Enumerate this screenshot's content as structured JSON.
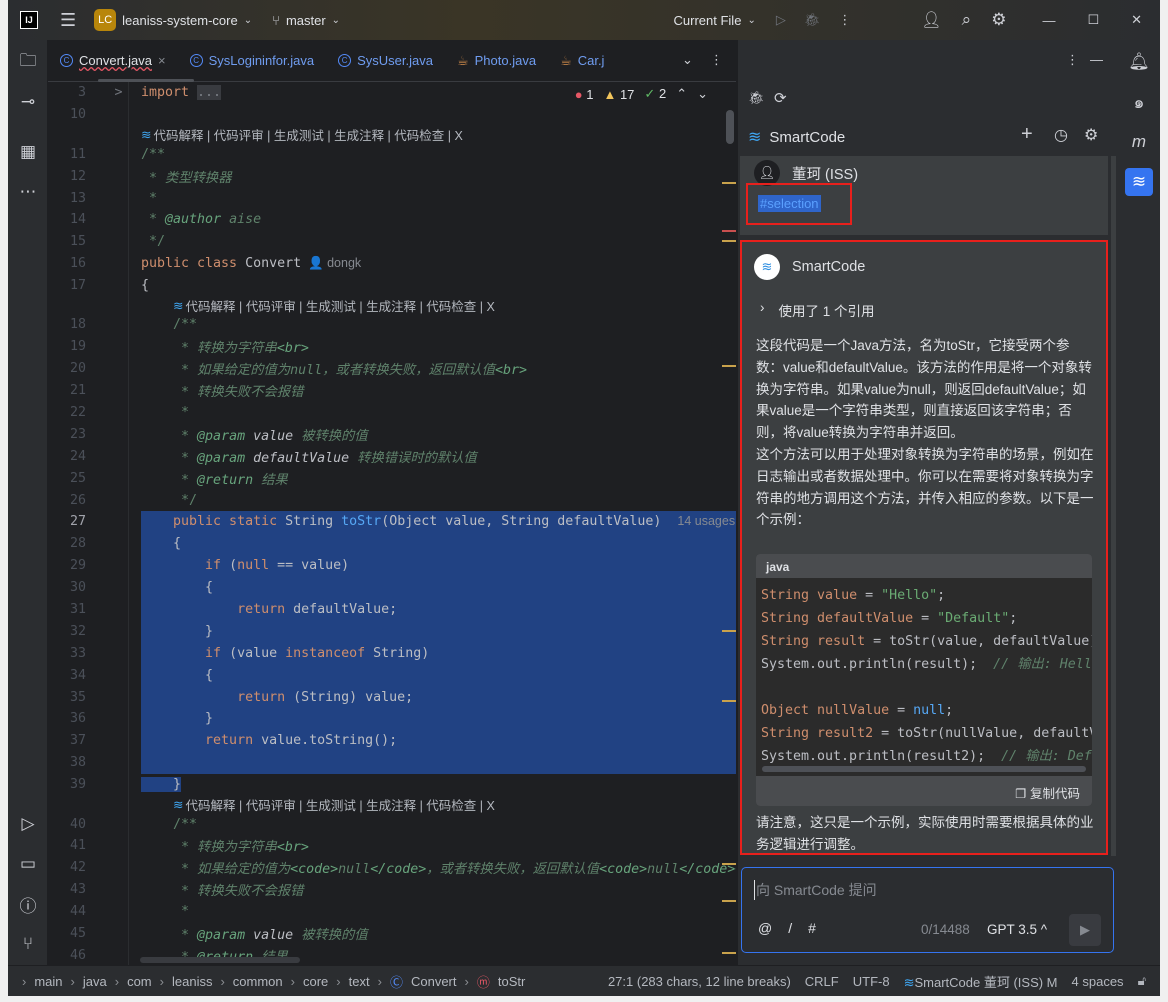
{
  "titlebar": {
    "logo": "IJ",
    "project_badge": "LC",
    "project": "leaniss-system-core",
    "branch": "master",
    "run_config": "Current File"
  },
  "tabs": [
    {
      "label": "Convert.java",
      "icon": "class-icon",
      "active": true,
      "close": "×"
    },
    {
      "label": "SysLogininfor.java",
      "icon": "class-icon"
    },
    {
      "label": "SysUser.java",
      "icon": "class-icon"
    },
    {
      "label": "Photo.java",
      "icon": "java-cup-icon"
    },
    {
      "label": "Car.j",
      "icon": "java-cup-icon"
    }
  ],
  "inspections": {
    "errors": "1",
    "warnings": "17",
    "ok": "2"
  },
  "lens": {
    "actions": "代码解释 | 代码评审 | 生成测试 | 生成注释 | 代码检查 | X"
  },
  "code_rows": [
    {
      "n": "3",
      "fold": ">",
      "seg": [
        {
          "t": "import ",
          "k": "kw"
        },
        {
          "t": "...",
          "k": "fold"
        }
      ]
    },
    {
      "n": "10",
      "seg": []
    },
    {
      "lens": true,
      "indent": ""
    },
    {
      "n": "11",
      "seg": [
        {
          "t": "/**",
          "k": "cmb"
        }
      ]
    },
    {
      "n": "12",
      "seg": [
        {
          "t": " * 类型转换器",
          "k": "cm"
        }
      ]
    },
    {
      "n": "13",
      "seg": [
        {
          "t": " *",
          "k": "cm"
        }
      ]
    },
    {
      "n": "14",
      "seg": [
        {
          "t": " * ",
          "k": "cm"
        },
        {
          "t": "@author",
          "k": "tag"
        },
        {
          "t": " aise",
          "k": "cm"
        }
      ]
    },
    {
      "n": "15",
      "seg": [
        {
          "t": " */",
          "k": "cmb"
        }
      ]
    },
    {
      "n": "16",
      "seg": [
        {
          "t": "public class ",
          "k": "kw"
        },
        {
          "t": "Convert",
          "k": "pl"
        },
        {
          "t": "  👤 dongk",
          "k": "hint"
        }
      ]
    },
    {
      "n": "17",
      "seg": [
        {
          "t": "{",
          "k": "pl"
        }
      ]
    },
    {
      "lens": true,
      "indent": "    "
    },
    {
      "n": "18",
      "seg": [
        {
          "t": "    /**",
          "k": "cmb"
        }
      ]
    },
    {
      "n": "19",
      "seg": [
        {
          "t": "     * 转换为字符串",
          "k": "cm"
        },
        {
          "t": "<br>",
          "k": "tag"
        }
      ]
    },
    {
      "n": "20",
      "seg": [
        {
          "t": "     * 如果给定的值为null，或者转换失败，返回默认值",
          "k": "cm"
        },
        {
          "t": "<br>",
          "k": "tag"
        }
      ]
    },
    {
      "n": "21",
      "seg": [
        {
          "t": "     * 转换失败不会报错",
          "k": "cm"
        }
      ]
    },
    {
      "n": "22",
      "seg": [
        {
          "t": "     *",
          "k": "cm"
        }
      ]
    },
    {
      "n": "23",
      "seg": [
        {
          "t": "     * ",
          "k": "cm"
        },
        {
          "t": "@param",
          "k": "tag"
        },
        {
          "t": " value",
          "k": "par"
        },
        {
          "t": " 被转换的值",
          "k": "cm"
        }
      ]
    },
    {
      "n": "24",
      "seg": [
        {
          "t": "     * ",
          "k": "cm"
        },
        {
          "t": "@param",
          "k": "tag"
        },
        {
          "t": " defaultValue",
          "k": "par"
        },
        {
          "t": " 转换错误时的默认值",
          "k": "cm"
        }
      ]
    },
    {
      "n": "25",
      "seg": [
        {
          "t": "     * ",
          "k": "cm"
        },
        {
          "t": "@return",
          "k": "tag"
        },
        {
          "t": " 结果",
          "k": "cm"
        }
      ]
    },
    {
      "n": "26",
      "seg": [
        {
          "t": "     */",
          "k": "cmb"
        }
      ]
    },
    {
      "n": "27",
      "sel": "full",
      "seg": [
        {
          "t": "    public static ",
          "k": "kw"
        },
        {
          "t": "String ",
          "k": "pl"
        },
        {
          "t": "toStr",
          "k": "fn"
        },
        {
          "t": "(Object value, String defaultValue)  ",
          "k": "pl"
        },
        {
          "t": "14 usages",
          "k": "hint"
        }
      ]
    },
    {
      "n": "28",
      "sel": "full",
      "seg": [
        {
          "t": "    {",
          "k": "pl"
        }
      ]
    },
    {
      "n": "29",
      "sel": "full",
      "seg": [
        {
          "t": "        if ",
          "k": "kw"
        },
        {
          "t": "(",
          "k": "pl"
        },
        {
          "t": "null",
          "k": "kw"
        },
        {
          "t": " == value)",
          "k": "pl"
        }
      ]
    },
    {
      "n": "30",
      "sel": "full",
      "seg": [
        {
          "t": "        {",
          "k": "pl"
        }
      ]
    },
    {
      "n": "31",
      "sel": "full",
      "seg": [
        {
          "t": "            return ",
          "k": "kw"
        },
        {
          "t": "defaultValue;",
          "k": "pl"
        }
      ]
    },
    {
      "n": "32",
      "sel": "full",
      "seg": [
        {
          "t": "        }",
          "k": "pl"
        }
      ]
    },
    {
      "n": "33",
      "sel": "full",
      "seg": [
        {
          "t": "        if ",
          "k": "kw"
        },
        {
          "t": "(value ",
          "k": "pl"
        },
        {
          "t": "instanceof ",
          "k": "kw"
        },
        {
          "t": "String)",
          "k": "pl"
        }
      ]
    },
    {
      "n": "34",
      "sel": "full",
      "seg": [
        {
          "t": "        {",
          "k": "pl"
        }
      ]
    },
    {
      "n": "35",
      "sel": "full",
      "seg": [
        {
          "t": "            return ",
          "k": "kw"
        },
        {
          "t": "(String) value;",
          "k": "pl"
        }
      ]
    },
    {
      "n": "36",
      "sel": "full",
      "seg": [
        {
          "t": "        }",
          "k": "pl"
        }
      ]
    },
    {
      "n": "37",
      "sel": "full",
      "seg": [
        {
          "t": "        return ",
          "k": "kw"
        },
        {
          "t": "value.toString();",
          "k": "pl"
        }
      ]
    },
    {
      "n": "38",
      "sel": "full",
      "seg": []
    },
    {
      "n": "39",
      "sel": "part",
      "seg": [
        {
          "t": "    }",
          "k": "pl"
        }
      ]
    },
    {
      "lens": true,
      "indent": "    "
    },
    {
      "n": "40",
      "seg": [
        {
          "t": "    /**",
          "k": "cmb"
        }
      ]
    },
    {
      "n": "41",
      "seg": [
        {
          "t": "     * 转换为字符串",
          "k": "cm"
        },
        {
          "t": "<br>",
          "k": "tag"
        }
      ]
    },
    {
      "n": "42",
      "seg": [
        {
          "t": "     * 如果给定的值为",
          "k": "cm"
        },
        {
          "t": "<code>",
          "k": "tag"
        },
        {
          "t": "null",
          "k": "cm"
        },
        {
          "t": "</code>",
          "k": "tag"
        },
        {
          "t": "，或者转换失败，返回默认值",
          "k": "cm"
        },
        {
          "t": "<code>",
          "k": "tag"
        },
        {
          "t": "null",
          "k": "cm"
        },
        {
          "t": "</code><",
          "k": "tag"
        }
      ]
    },
    {
      "n": "43",
      "seg": [
        {
          "t": "     * 转换失败不会报错",
          "k": "cm"
        }
      ]
    },
    {
      "n": "44",
      "seg": [
        {
          "t": "     *",
          "k": "cm"
        }
      ]
    },
    {
      "n": "45",
      "seg": [
        {
          "t": "     * ",
          "k": "cm"
        },
        {
          "t": "@param",
          "k": "tag"
        },
        {
          "t": " value",
          "k": "par"
        },
        {
          "t": " 被转换的值",
          "k": "cm"
        }
      ]
    },
    {
      "n": "46",
      "seg": [
        {
          "t": "     * ",
          "k": "cm"
        },
        {
          "t": "@return",
          "k": "tag"
        },
        {
          "t": " 结果",
          "k": "cm"
        }
      ]
    }
  ],
  "chat": {
    "title": "SmartCode",
    "user": {
      "name": "董珂 (ISS)",
      "message": "#selection"
    },
    "ai": {
      "name": "SmartCode",
      "refs": "使用了 1 个引用",
      "para1": "这段代码是一个Java方法，名为toStr，它接受两个参数：value和defaultValue。该方法的作用是将一个对象转换为字符串。如果value为null，则返回defaultValue；如果value是一个字符串类型，则直接返回该字符串；否则，将value转换为字符串并返回。",
      "para2": "这个方法可以用于处理对象转换为字符串的场景，例如在日志输出或者数据处理中。你可以在需要将对象转换为字符串的地方调用这个方法，并传入相应的参数。以下是一个示例：",
      "code_lang": "java",
      "code_lines": [
        [
          {
            "t": "String ",
            "k": "kw"
          },
          {
            "t": "value",
            "k": "kw"
          },
          {
            "t": " = ",
            "k": "pl"
          },
          {
            "t": "\"Hello\"",
            "k": "str"
          },
          {
            "t": ";",
            "k": "pl"
          }
        ],
        [
          {
            "t": "String ",
            "k": "kw"
          },
          {
            "t": "defaultValue",
            "k": "kw"
          },
          {
            "t": " = ",
            "k": "pl"
          },
          {
            "t": "\"Default\"",
            "k": "str"
          },
          {
            "t": ";",
            "k": "pl"
          }
        ],
        [
          {
            "t": "String ",
            "k": "kw"
          },
          {
            "t": "result",
            "k": "kw"
          },
          {
            "t": " = toStr(value, defaultValue);",
            "k": "pl"
          }
        ],
        [
          {
            "t": "System.out.println(result);  ",
            "k": "pl"
          },
          {
            "t": "// 输出: Hello",
            "k": "cm"
          }
        ],
        [],
        [
          {
            "t": "Object ",
            "k": "kw"
          },
          {
            "t": "nullValue",
            "k": "kw"
          },
          {
            "t": " = ",
            "k": "pl"
          },
          {
            "t": "null",
            "k": "fn"
          },
          {
            "t": ";",
            "k": "pl"
          }
        ],
        [
          {
            "t": "String ",
            "k": "kw"
          },
          {
            "t": "result2",
            "k": "kw"
          },
          {
            "t": " = toStr(nullValue, defaultValue);",
            "k": "pl"
          }
        ],
        [
          {
            "t": "System.out.println(result2);  ",
            "k": "pl"
          },
          {
            "t": "// 输出: Default",
            "k": "cm"
          }
        ]
      ],
      "copy": "复制代码",
      "para3": "请注意，这只是一个示例，实际使用时需要根据具体的业务逻辑进行调整。"
    },
    "input": {
      "placeholder": "向 SmartCode 提问",
      "at": "@",
      "slash": "/",
      "hash": "#",
      "count": "0/14488",
      "model": "GPT 3.5 ^"
    }
  },
  "status": {
    "breadcrumb": [
      "main",
      "java",
      "com",
      "leaniss",
      "common",
      "core",
      "text",
      "Convert",
      "toStr"
    ],
    "position": "27:1 (283 chars, 12 line breaks)",
    "line_sep": "CRLF",
    "encoding": "UTF-8",
    "plugin": "SmartCode 董珂 (ISS) M",
    "indent": "4 spaces"
  },
  "colors": {
    "accent": "#3574f0",
    "selection": "#214283",
    "highlight_border": "#e8201c"
  }
}
